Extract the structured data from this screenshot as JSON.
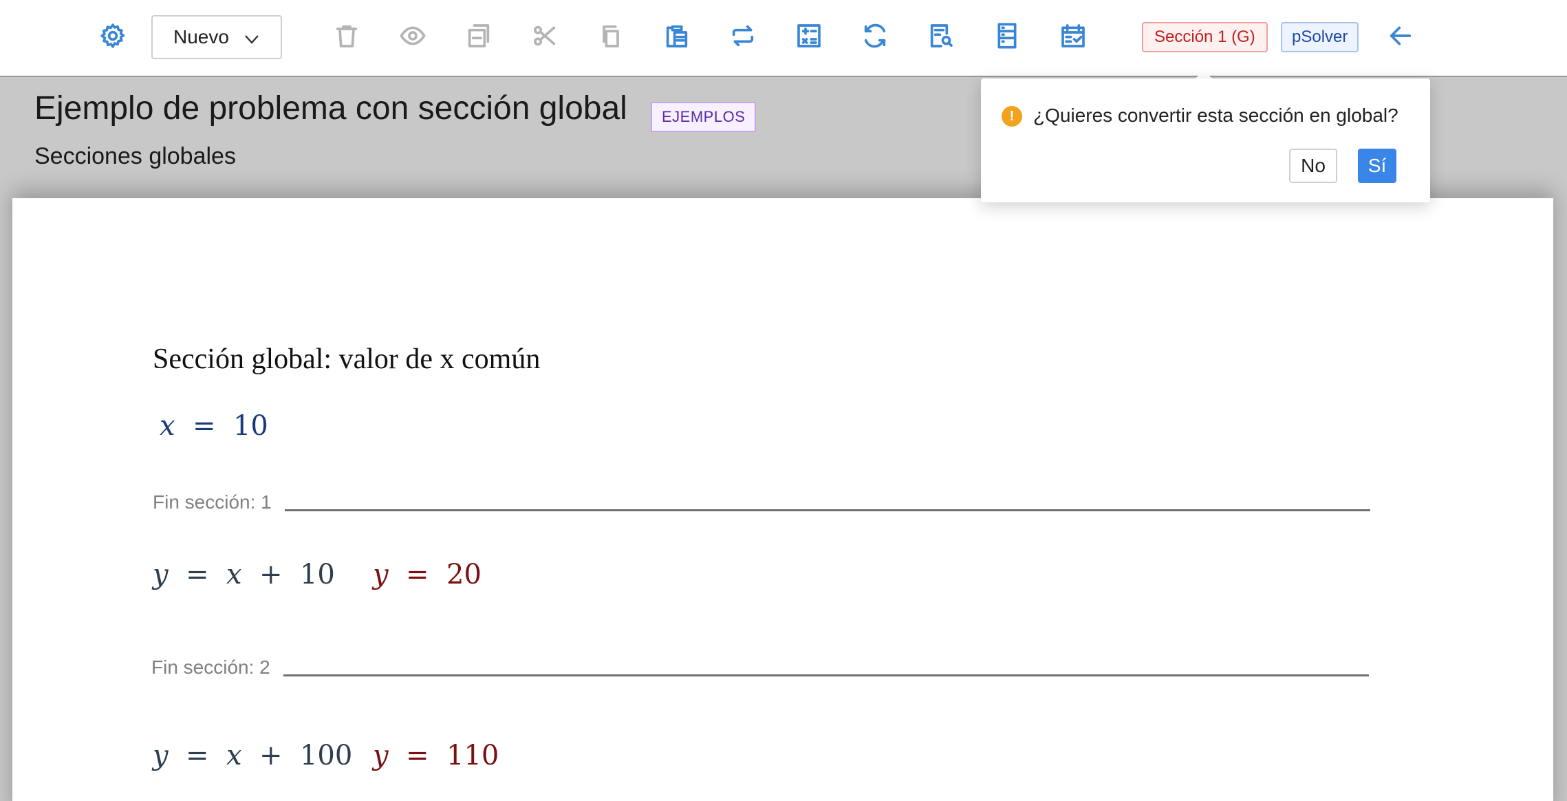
{
  "toolbar": {
    "new_button_label": "Nuevo",
    "icons": [
      {
        "name": "settings-icon",
        "state": "active"
      },
      {
        "name": "delete-icon",
        "state": "disabled"
      },
      {
        "name": "preview-icon",
        "state": "disabled"
      },
      {
        "name": "duplicate-icon",
        "state": "disabled"
      },
      {
        "name": "cut-icon",
        "state": "disabled"
      },
      {
        "name": "copy-icon",
        "state": "disabled"
      },
      {
        "name": "paste-icon",
        "state": "active"
      },
      {
        "name": "repeat-icon",
        "state": "active"
      },
      {
        "name": "calculator-icon",
        "state": "active"
      },
      {
        "name": "refresh-icon",
        "state": "active"
      },
      {
        "name": "inspect-document-icon",
        "state": "active"
      },
      {
        "name": "sections-icon",
        "state": "active"
      },
      {
        "name": "calendar-check-icon",
        "state": "active"
      }
    ],
    "section_badge": "Sección 1 (G)",
    "psolver_badge": "pSolver",
    "back_icon": "arrow-left-icon"
  },
  "header": {
    "title": "Ejemplo de problema con sección global",
    "tag": "EJEMPLOS",
    "subtitle": "Secciones globales"
  },
  "popover": {
    "message": "¿Quieres convertir esta sección en global?",
    "no_label": "No",
    "yes_label": "Sí"
  },
  "document": {
    "section_title": "Sección global: valor de x común",
    "sections": [
      {
        "equation": {
          "lhs": "x",
          "rhs": "10"
        },
        "end_label": "Fin sección: 1"
      },
      {
        "equation": {
          "lhs": "y",
          "rhs_var": "x",
          "rhs_const": "10"
        },
        "result": {
          "lhs": "y",
          "value": "20"
        },
        "end_label": "Fin sección: 2"
      },
      {
        "equation": {
          "lhs": "y",
          "rhs_var": "x",
          "rhs_const": "100"
        },
        "result": {
          "lhs": "y",
          "value": "110"
        }
      }
    ]
  },
  "colors": {
    "accent": "#3a86d6",
    "disabled": "#b4b4b4",
    "section_badge": "#c21f1f",
    "psolver_badge": "#1c48a8",
    "tag": "#5a2aa8",
    "result": "#7a1010",
    "warning": "#f1a21f",
    "yes_button": "#3a86e8"
  }
}
